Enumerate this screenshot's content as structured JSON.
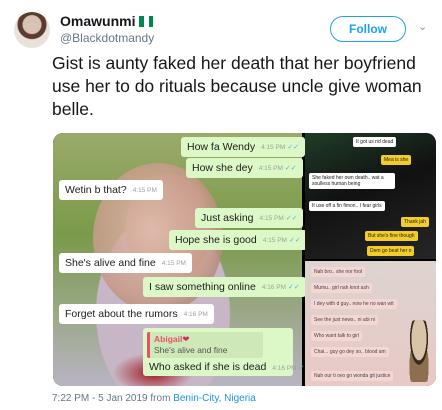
{
  "tweet": {
    "display_name": "Omawunmi",
    "handle": "@Blackdotmandy",
    "follow_label": "Follow",
    "text": "Gist is aunty faked her death that her boyfriend use her to do rituals because uncle give woman belle.",
    "timestamp": "7:22 PM - 5 Jan 2019 from",
    "location": "Benin-City, Nigeria",
    "flag_colors": [
      "#008751",
      "#ffffff",
      "#008751"
    ],
    "icons": [
      "flag-nigeria-icon",
      "chevron-down-icon"
    ]
  },
  "chat": {
    "bubbles": [
      {
        "text": "How fa Wendy",
        "time": "4:15 PM",
        "dir": "out"
      },
      {
        "text": "How she dey",
        "time": "4:15 PM",
        "dir": "out"
      },
      {
        "text": "Wetin b that?",
        "time": "4:15 PM",
        "dir": "in"
      },
      {
        "text": "Just asking",
        "time": "4:15 PM",
        "dir": "out"
      },
      {
        "text": "Hope she is good",
        "time": "4:15 PM",
        "dir": "out"
      },
      {
        "text": "She's alive and fine",
        "time": "4:15 PM",
        "dir": "in"
      },
      {
        "text": "I saw something online",
        "time": "4:16 PM",
        "dir": "out"
      },
      {
        "text": "Forget about the rumors",
        "time": "4:16 PM",
        "dir": "in"
      }
    ],
    "reply": {
      "quote_author": "Abigail",
      "quote_text": "She's alive and fine",
      "text": "Who asked if she is dead",
      "time": "4:16 PM"
    },
    "colors": {
      "outgoing": "#dcf8c6",
      "incoming": "#ffffff",
      "tick": "#52b5e8"
    }
  },
  "side_top": {
    "lines": [
      "It got us nd dead",
      "Mea is she",
      "She faked her own death.. wat a soulless human being",
      "It use off a fin fimon.. I fear girls",
      "Thank jah",
      "But she's fine though",
      "Dem go beat her o"
    ]
  },
  "side_bottom": {
    "lines": [
      "Nah bro.. she nor fool",
      "Mumu.. girl nah knot ash",
      "I dey with d guy.. now he no wan wit",
      "See the just news.. ni abi ni",
      "Who want talk to girl",
      "Chai... guy go dey so.. blood am",
      "Nah our ti ovo go wonda git justice"
    ]
  }
}
